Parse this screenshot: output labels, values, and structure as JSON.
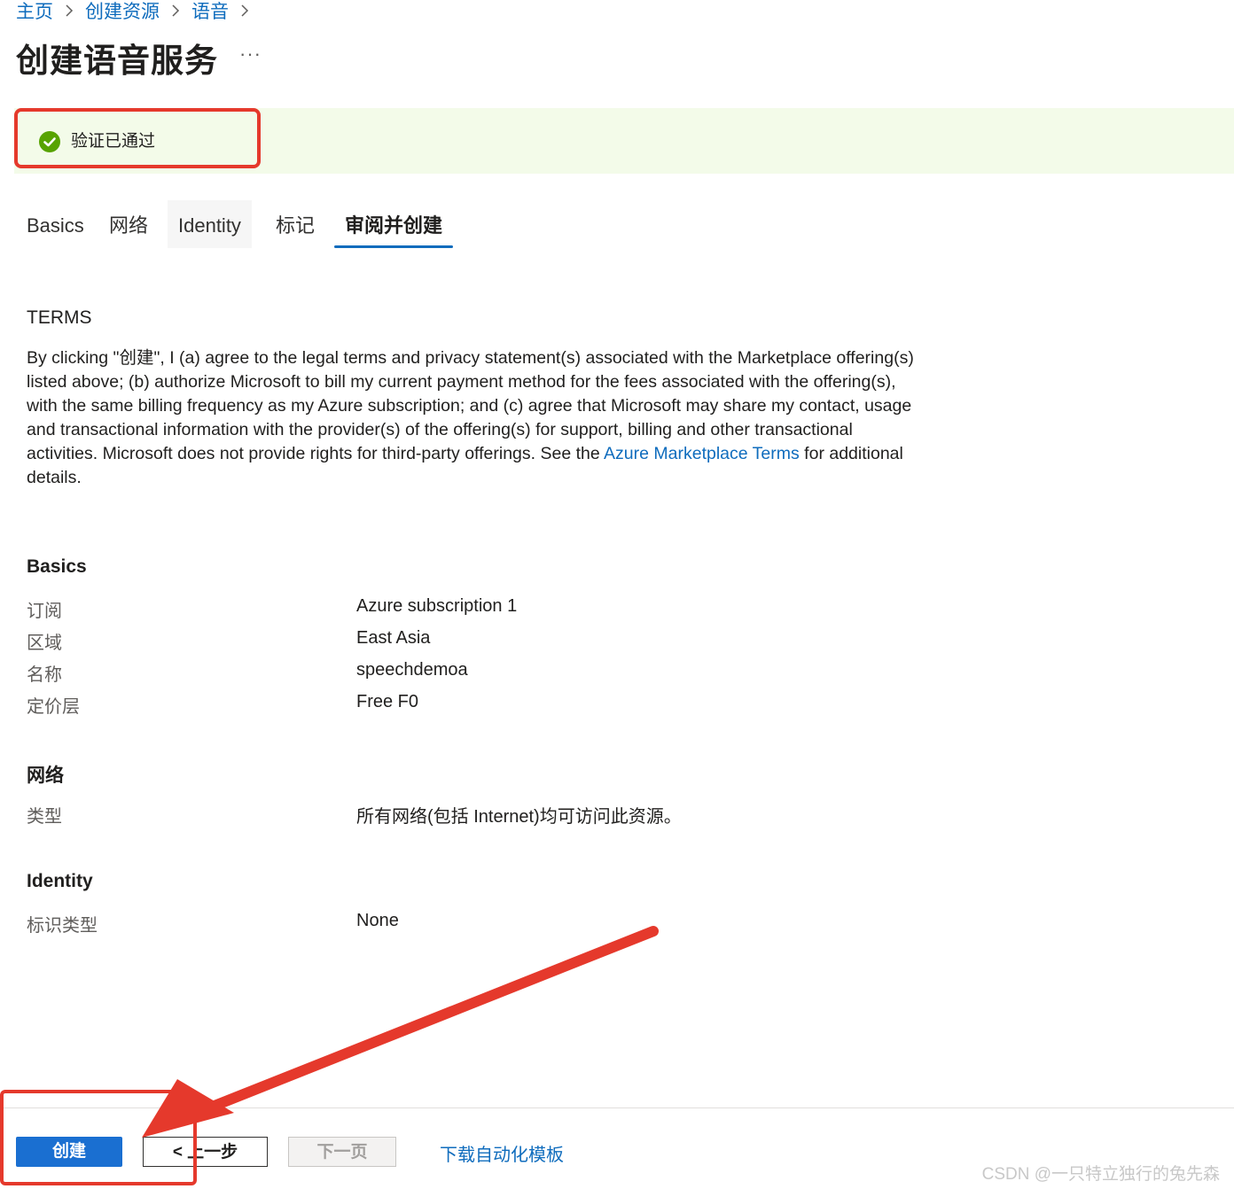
{
  "breadcrumb": {
    "items": [
      "主页",
      "创建资源",
      "语音"
    ],
    "separator": ">"
  },
  "page": {
    "title": "创建语音服务",
    "more": "···"
  },
  "validation": {
    "message": "验证已通过",
    "status_color": "#57a300"
  },
  "tabs": [
    {
      "label": "Basics"
    },
    {
      "label": "网络"
    },
    {
      "label": "Identity"
    },
    {
      "label": "标记"
    },
    {
      "label": "审阅并创建",
      "active": true
    }
  ],
  "terms": {
    "title": "TERMS",
    "body_before": "By clicking \"创建\", I (a) agree to the legal terms and privacy statement(s) associated with the Marketplace offering(s) listed above; (b) authorize Microsoft to bill my current payment method for the fees associated with the offering(s), with the same billing frequency as my Azure subscription; and (c) agree that Microsoft may share my contact, usage and transactional information with the provider(s) of the offering(s) for support, billing and other transactional activities. Microsoft does not provide rights for third-party offerings. See the ",
    "link_text": "Azure Marketplace Terms",
    "body_after": " for additional details."
  },
  "sections": {
    "basics": {
      "title": "Basics",
      "rows": [
        {
          "label": "订阅",
          "value": "Azure subscription 1"
        },
        {
          "label": "区域",
          "value": "East Asia"
        },
        {
          "label": "名称",
          "value": "speechdemoa"
        },
        {
          "label": "定价层",
          "value": "Free F0"
        }
      ]
    },
    "network": {
      "title": "网络",
      "rows": [
        {
          "label": "类型",
          "value": "所有网络(包括 Internet)均可访问此资源。"
        }
      ]
    },
    "identity": {
      "title": "Identity",
      "rows": [
        {
          "label": "标识类型",
          "value": "None"
        }
      ]
    }
  },
  "footer": {
    "create_label": "创建",
    "prev_label": "< 上一步",
    "next_label": "下一页",
    "download_label": "下载自动化模板"
  },
  "watermark": "CSDN @一只特立独行的兔先森",
  "colors": {
    "accent": "#0f6cbd",
    "primary_button": "#1a6fd1",
    "annotation_red": "#e5392c"
  }
}
